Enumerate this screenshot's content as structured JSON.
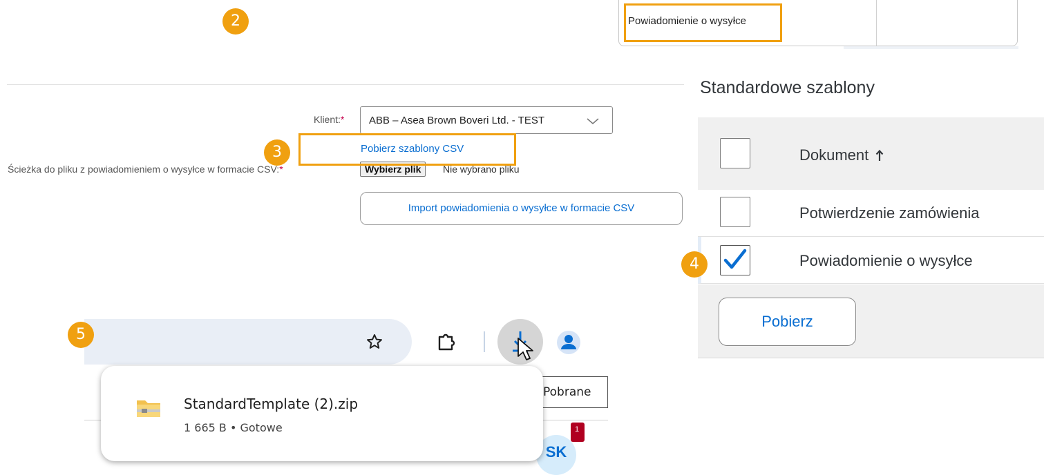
{
  "steps": {
    "s2": "2",
    "s3": "3",
    "s4": "4",
    "s5": "5"
  },
  "menu": {
    "item": "Powiadomienie o wysyłce"
  },
  "form": {
    "client_label": "Klient:",
    "client_value": "ABB – Asea Brown Boveri Ltd. - TEST",
    "download_templates_link": "Pobierz szablony CSV",
    "file_path_label": "Ścieżka do pliku z powiadomieniem o wysyłce w formacie CSV:",
    "choose_file_button": "Wybierz plik",
    "no_file_text": "Nie wybrano pliku",
    "import_button": "Import powiadomienia o wysyłce w formacie CSV",
    "required_mark": "*"
  },
  "templates": {
    "title": "Standardowe szablony",
    "header": "Dokument",
    "rows": [
      {
        "label": "Potwierdzenie zamówienia",
        "checked": false
      },
      {
        "label": "Powiadomienie o wysyłce",
        "checked": true
      }
    ],
    "download_button": "Pobierz"
  },
  "browser": {
    "download_filename": "StandardTemplate (2).zip",
    "download_meta": "1 665 B • Gotowe",
    "tooltip": "Pobrane",
    "avatar_initials": "SK",
    "notification_count": "1"
  },
  "colors": {
    "highlight": "#f0a010",
    "link": "#0a6ed1",
    "checkbox_accent": "#0a6ed1"
  },
  "icons": [
    "star-icon",
    "extensions-icon",
    "download-icon",
    "profile-icon",
    "zip-folder-icon",
    "chevron-down-icon",
    "checkmark-icon",
    "sort-up-arrow-icon",
    "cursor-icon"
  ]
}
